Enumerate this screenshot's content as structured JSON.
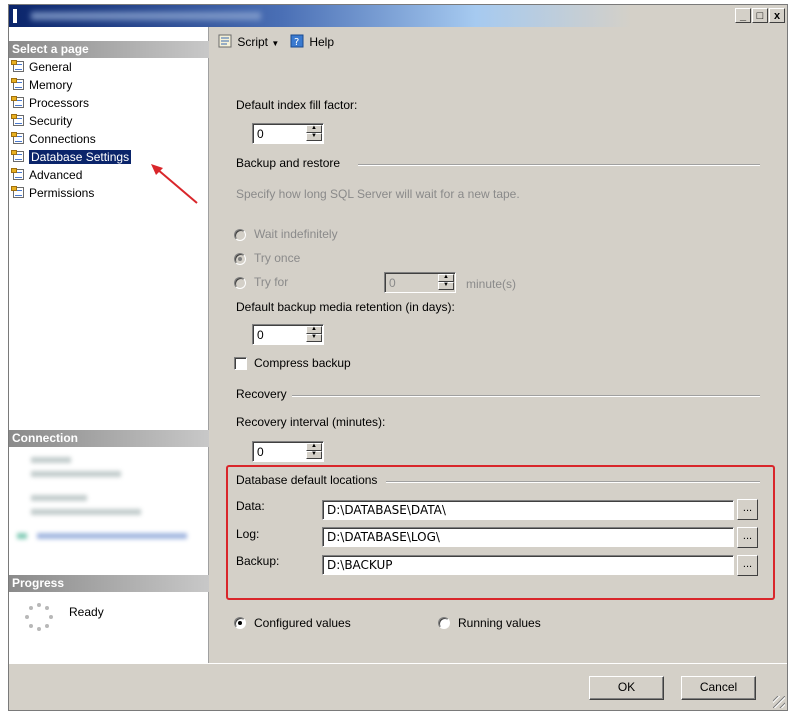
{
  "window": {
    "minimize": "_",
    "maximize": "□",
    "close": "x"
  },
  "sidebar": {
    "select_page_header": "Select a page",
    "items": [
      {
        "label": "General"
      },
      {
        "label": "Memory"
      },
      {
        "label": "Processors"
      },
      {
        "label": "Security"
      },
      {
        "label": "Connections"
      },
      {
        "label": "Database Settings"
      },
      {
        "label": "Advanced"
      },
      {
        "label": "Permissions"
      }
    ],
    "connection_header": "Connection",
    "progress_header": "Progress",
    "progress_status": "Ready"
  },
  "toolbar": {
    "script_label": "Script",
    "help_label": "Help"
  },
  "form": {
    "fill_factor_label": "Default index fill factor:",
    "fill_factor_value": "0",
    "backup_restore_header": "Backup and restore",
    "backup_restore_desc": "Specify how long SQL Server will wait for a new tape.",
    "wait_indefinitely": "Wait indefinitely",
    "try_once": "Try once",
    "try_for": "Try for",
    "try_for_value": "0",
    "minutes_unit": "minute(s)",
    "retention_label": "Default backup media retention (in days):",
    "retention_value": "0",
    "compress_backup": "Compress backup",
    "recovery_header": "Recovery",
    "recovery_interval_label": "Recovery interval (minutes):",
    "recovery_interval_value": "0",
    "locations_header": "Database default locations",
    "data_label": "Data:",
    "data_value": "D:\\DATABASE\\DATA\\",
    "log_label": "Log:",
    "log_value": "D:\\DATABASE\\LOG\\",
    "backup_label": "Backup:",
    "backup_value": "D:\\BACKUP",
    "browse": "...",
    "configured_values": "Configured values",
    "running_values": "Running values"
  },
  "buttons": {
    "ok": "OK",
    "cancel": "Cancel"
  },
  "colors": {
    "highlight": "#d9262b",
    "selection": "#0a246a"
  }
}
